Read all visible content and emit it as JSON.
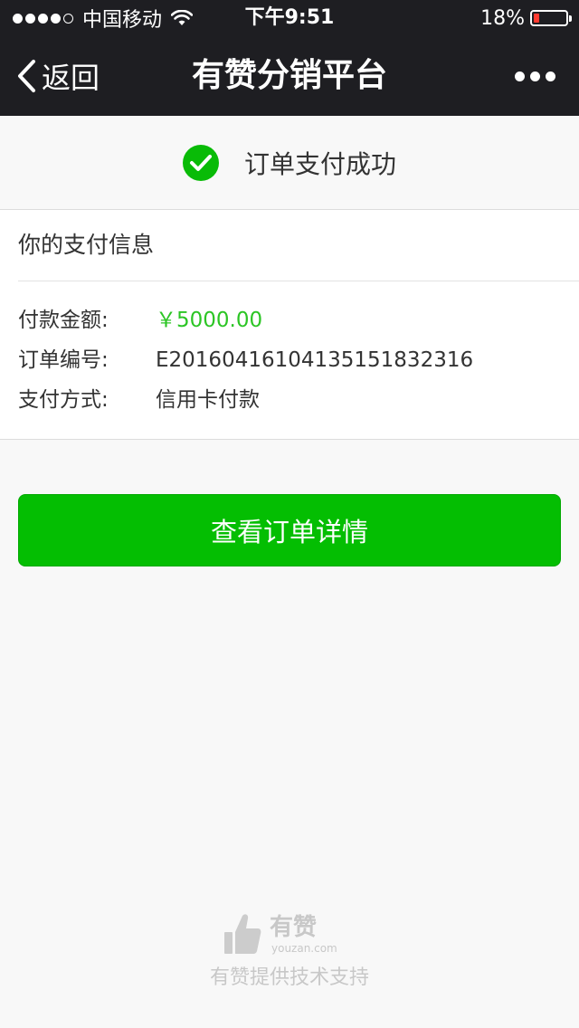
{
  "status_bar": {
    "carrier": "中国移动",
    "time": "下午9:51",
    "battery_percent": "18%",
    "battery_level": 0.18
  },
  "nav": {
    "back_label": "返回",
    "title": "有赞分销平台",
    "more_icon": "more-dots-icon"
  },
  "banner": {
    "message": "订单支付成功",
    "icon": "check-circle-icon"
  },
  "payment_info": {
    "header": "你的支付信息",
    "rows": [
      {
        "label": "付款金额:",
        "value": "￥5000.00"
      },
      {
        "label": "订单编号:",
        "value": "E20160416104135151832316"
      },
      {
        "label": "支付方式:",
        "value": "信用卡付款"
      }
    ]
  },
  "actions": {
    "view_order_label": "查看订单详情"
  },
  "footer": {
    "logo_name": "有赞",
    "logo_domain": "youzan.com",
    "powered_by": "有赞提供技术支持"
  },
  "colors": {
    "nav_bg": "#1e1e22",
    "accent_green": "#04be02",
    "amount_green": "#2cc525",
    "battery_red": "#ff3b30"
  }
}
